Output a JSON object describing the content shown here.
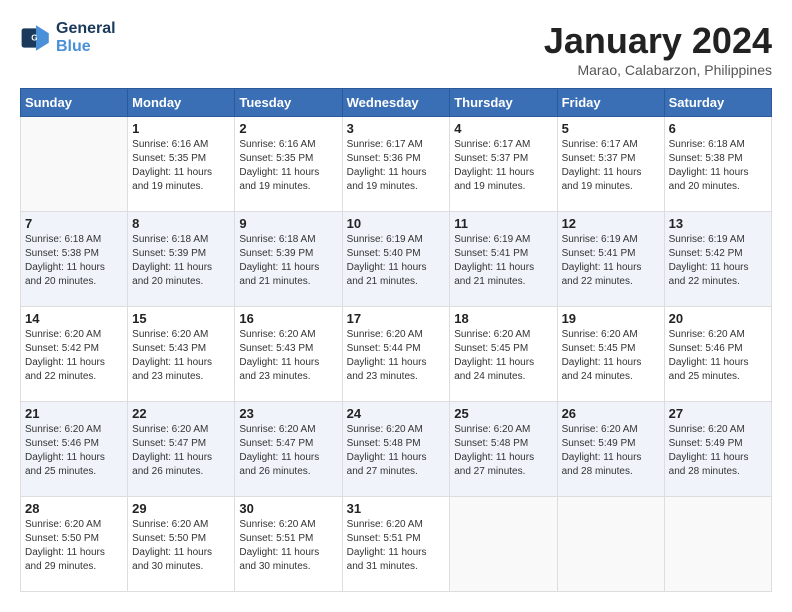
{
  "header": {
    "logo_line1": "General",
    "logo_line2": "Blue",
    "month_title": "January 2024",
    "location": "Marao, Calabarzon, Philippines"
  },
  "weekdays": [
    "Sunday",
    "Monday",
    "Tuesday",
    "Wednesday",
    "Thursday",
    "Friday",
    "Saturday"
  ],
  "weeks": [
    [
      {
        "day": "",
        "sunrise": "",
        "sunset": "",
        "daylight": ""
      },
      {
        "day": "1",
        "sunrise": "Sunrise: 6:16 AM",
        "sunset": "Sunset: 5:35 PM",
        "daylight": "Daylight: 11 hours and 19 minutes."
      },
      {
        "day": "2",
        "sunrise": "Sunrise: 6:16 AM",
        "sunset": "Sunset: 5:35 PM",
        "daylight": "Daylight: 11 hours and 19 minutes."
      },
      {
        "day": "3",
        "sunrise": "Sunrise: 6:17 AM",
        "sunset": "Sunset: 5:36 PM",
        "daylight": "Daylight: 11 hours and 19 minutes."
      },
      {
        "day": "4",
        "sunrise": "Sunrise: 6:17 AM",
        "sunset": "Sunset: 5:37 PM",
        "daylight": "Daylight: 11 hours and 19 minutes."
      },
      {
        "day": "5",
        "sunrise": "Sunrise: 6:17 AM",
        "sunset": "Sunset: 5:37 PM",
        "daylight": "Daylight: 11 hours and 19 minutes."
      },
      {
        "day": "6",
        "sunrise": "Sunrise: 6:18 AM",
        "sunset": "Sunset: 5:38 PM",
        "daylight": "Daylight: 11 hours and 20 minutes."
      }
    ],
    [
      {
        "day": "7",
        "sunrise": "Sunrise: 6:18 AM",
        "sunset": "Sunset: 5:38 PM",
        "daylight": "Daylight: 11 hours and 20 minutes."
      },
      {
        "day": "8",
        "sunrise": "Sunrise: 6:18 AM",
        "sunset": "Sunset: 5:39 PM",
        "daylight": "Daylight: 11 hours and 20 minutes."
      },
      {
        "day": "9",
        "sunrise": "Sunrise: 6:18 AM",
        "sunset": "Sunset: 5:39 PM",
        "daylight": "Daylight: 11 hours and 21 minutes."
      },
      {
        "day": "10",
        "sunrise": "Sunrise: 6:19 AM",
        "sunset": "Sunset: 5:40 PM",
        "daylight": "Daylight: 11 hours and 21 minutes."
      },
      {
        "day": "11",
        "sunrise": "Sunrise: 6:19 AM",
        "sunset": "Sunset: 5:41 PM",
        "daylight": "Daylight: 11 hours and 21 minutes."
      },
      {
        "day": "12",
        "sunrise": "Sunrise: 6:19 AM",
        "sunset": "Sunset: 5:41 PM",
        "daylight": "Daylight: 11 hours and 22 minutes."
      },
      {
        "day": "13",
        "sunrise": "Sunrise: 6:19 AM",
        "sunset": "Sunset: 5:42 PM",
        "daylight": "Daylight: 11 hours and 22 minutes."
      }
    ],
    [
      {
        "day": "14",
        "sunrise": "Sunrise: 6:20 AM",
        "sunset": "Sunset: 5:42 PM",
        "daylight": "Daylight: 11 hours and 22 minutes."
      },
      {
        "day": "15",
        "sunrise": "Sunrise: 6:20 AM",
        "sunset": "Sunset: 5:43 PM",
        "daylight": "Daylight: 11 hours and 23 minutes."
      },
      {
        "day": "16",
        "sunrise": "Sunrise: 6:20 AM",
        "sunset": "Sunset: 5:43 PM",
        "daylight": "Daylight: 11 hours and 23 minutes."
      },
      {
        "day": "17",
        "sunrise": "Sunrise: 6:20 AM",
        "sunset": "Sunset: 5:44 PM",
        "daylight": "Daylight: 11 hours and 23 minutes."
      },
      {
        "day": "18",
        "sunrise": "Sunrise: 6:20 AM",
        "sunset": "Sunset: 5:45 PM",
        "daylight": "Daylight: 11 hours and 24 minutes."
      },
      {
        "day": "19",
        "sunrise": "Sunrise: 6:20 AM",
        "sunset": "Sunset: 5:45 PM",
        "daylight": "Daylight: 11 hours and 24 minutes."
      },
      {
        "day": "20",
        "sunrise": "Sunrise: 6:20 AM",
        "sunset": "Sunset: 5:46 PM",
        "daylight": "Daylight: 11 hours and 25 minutes."
      }
    ],
    [
      {
        "day": "21",
        "sunrise": "Sunrise: 6:20 AM",
        "sunset": "Sunset: 5:46 PM",
        "daylight": "Daylight: 11 hours and 25 minutes."
      },
      {
        "day": "22",
        "sunrise": "Sunrise: 6:20 AM",
        "sunset": "Sunset: 5:47 PM",
        "daylight": "Daylight: 11 hours and 26 minutes."
      },
      {
        "day": "23",
        "sunrise": "Sunrise: 6:20 AM",
        "sunset": "Sunset: 5:47 PM",
        "daylight": "Daylight: 11 hours and 26 minutes."
      },
      {
        "day": "24",
        "sunrise": "Sunrise: 6:20 AM",
        "sunset": "Sunset: 5:48 PM",
        "daylight": "Daylight: 11 hours and 27 minutes."
      },
      {
        "day": "25",
        "sunrise": "Sunrise: 6:20 AM",
        "sunset": "Sunset: 5:48 PM",
        "daylight": "Daylight: 11 hours and 27 minutes."
      },
      {
        "day": "26",
        "sunrise": "Sunrise: 6:20 AM",
        "sunset": "Sunset: 5:49 PM",
        "daylight": "Daylight: 11 hours and 28 minutes."
      },
      {
        "day": "27",
        "sunrise": "Sunrise: 6:20 AM",
        "sunset": "Sunset: 5:49 PM",
        "daylight": "Daylight: 11 hours and 28 minutes."
      }
    ],
    [
      {
        "day": "28",
        "sunrise": "Sunrise: 6:20 AM",
        "sunset": "Sunset: 5:50 PM",
        "daylight": "Daylight: 11 hours and 29 minutes."
      },
      {
        "day": "29",
        "sunrise": "Sunrise: 6:20 AM",
        "sunset": "Sunset: 5:50 PM",
        "daylight": "Daylight: 11 hours and 30 minutes."
      },
      {
        "day": "30",
        "sunrise": "Sunrise: 6:20 AM",
        "sunset": "Sunset: 5:51 PM",
        "daylight": "Daylight: 11 hours and 30 minutes."
      },
      {
        "day": "31",
        "sunrise": "Sunrise: 6:20 AM",
        "sunset": "Sunset: 5:51 PM",
        "daylight": "Daylight: 11 hours and 31 minutes."
      },
      {
        "day": "",
        "sunrise": "",
        "sunset": "",
        "daylight": ""
      },
      {
        "day": "",
        "sunrise": "",
        "sunset": "",
        "daylight": ""
      },
      {
        "day": "",
        "sunrise": "",
        "sunset": "",
        "daylight": ""
      }
    ]
  ]
}
